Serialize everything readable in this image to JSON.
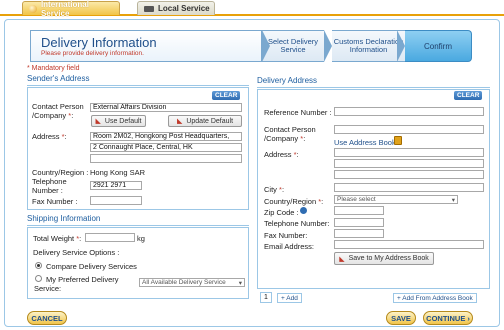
{
  "tabs": {
    "international": "International Service",
    "local": "Local Service"
  },
  "steps": {
    "current_title": "Delivery Information",
    "current_sub": "Please provide delivery information.",
    "step2": "Select Delivery Service",
    "step3": "Customs Declaration Information",
    "step4": "Confirm"
  },
  "mandatory": "* Mandatory field",
  "sender": {
    "title": "Sender's Address",
    "clear": "CLEAR",
    "contact_label": "Contact Person /Company",
    "contact_value": "External Affairs Division",
    "use_default": "Use Default",
    "update_default": "Update Default",
    "address_label": "Address",
    "address_line1": "Room 2M02, Hongkong Post Headquarters,",
    "address_line2": "2 Connaught Place, Central, HK",
    "address_line3": "",
    "country_label": "Country/Region",
    "country_value": "Hong Kong SAR",
    "telephone_label": "Telephone Number",
    "telephone_value": "2921 2971",
    "fax_label": "Fax Number",
    "fax_value": ""
  },
  "shipping": {
    "title": "Shipping Information",
    "weight_label": "Total Weight",
    "weight_unit": "kg",
    "options_label": "Delivery Service Options :",
    "opt_compare": "Compare Delivery Services",
    "opt_preferred": "My Preferred Delivery Service:",
    "preferred_select": "All Available Delivery Service"
  },
  "delivery": {
    "title": "Delivery Address",
    "clear": "CLEAR",
    "reference_label": "Reference Number :",
    "contact_label": "Contact Person /Company",
    "use_address_book": "Use Address Book",
    "address_label": "Address",
    "city_label": "City",
    "country_label": "Country/Region",
    "country_select": "Please select",
    "zip_label": "Zip Code :",
    "telephone_label": "Telephone Number:",
    "fax_label": "Fax Number:",
    "email_label": "Email Address:",
    "save_button": "Save to My Address Book",
    "page_tab": "1",
    "add_link": "+ Add",
    "add_from_book": "+ Add From Address Book"
  },
  "footer": {
    "cancel": "CANCEL",
    "save": "SAVE",
    "continue": "CONTINUE"
  },
  "colors": {
    "accent": "#1f5fa0",
    "required": "#c0392b",
    "tab_gold": "#f1c447"
  }
}
